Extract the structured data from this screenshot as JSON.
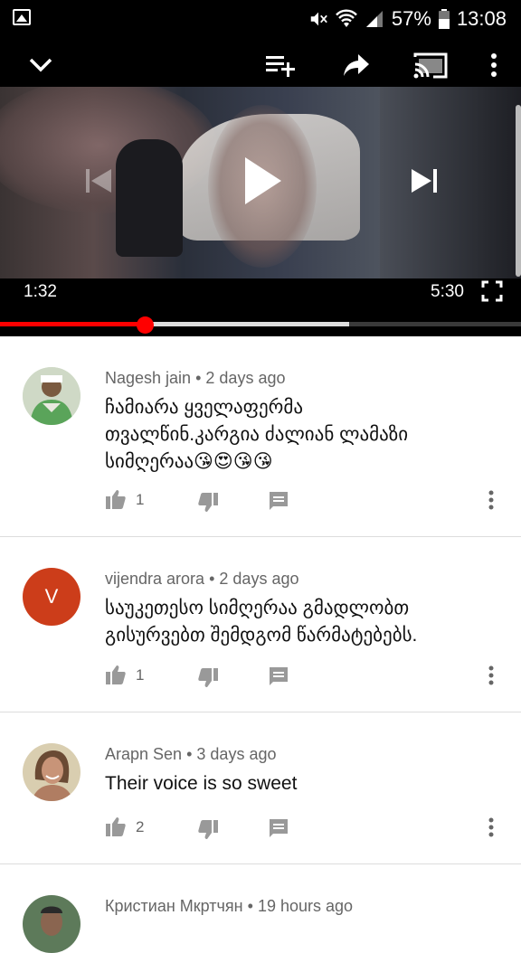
{
  "status_bar": {
    "battery": "57%",
    "time": "13:08"
  },
  "player": {
    "current_time": "1:32",
    "duration": "5:30",
    "progress_fraction": 0.28,
    "buffered_fraction": 0.67,
    "colors": {
      "progress": "#ff0000",
      "background": "#000000"
    },
    "icons": [
      "collapse-chevron-icon",
      "add-to-playlist-icon",
      "share-icon",
      "cast-icon",
      "more-vert-icon",
      "previous-icon",
      "play-icon",
      "next-icon",
      "fullscreen-icon"
    ]
  },
  "comments": [
    {
      "author": "Nagesh jain",
      "age": "2 days ago",
      "text_lines": [
        "ჩამიარა ყველაფერმა",
        "თვალწინ.კარგია ძალიან ლამაზი",
        "სიმღერაა😘😍😘😘"
      ],
      "likes": "1",
      "avatar_type": "photo",
      "avatar_colors": [
        "#6aa86a",
        "#e8e8e0"
      ]
    },
    {
      "author": "vijendra arora",
      "age": "2 days ago",
      "text_lines": [
        "საუკეთესო სიმღერაა გმადლობთ",
        "გისურვებთ შემდგომ წარმატებებს."
      ],
      "likes": "1",
      "avatar_type": "letter",
      "avatar_letter": "V",
      "avatar_colors": [
        "#cc3d1a"
      ]
    },
    {
      "author": "Arapn Sen",
      "age": "3 days ago",
      "text_lines": [
        "Their voice is so sweet"
      ],
      "likes": "2",
      "avatar_type": "photo",
      "avatar_colors": [
        "#d6c8a0",
        "#a8715a"
      ]
    },
    {
      "author": "Кристиан Мкртчян",
      "age": "19 hours ago",
      "text_lines": [],
      "likes": "",
      "avatar_type": "photo",
      "avatar_colors": [
        "#4a6a4a",
        "#8a6a55"
      ]
    }
  ],
  "separator": "•"
}
